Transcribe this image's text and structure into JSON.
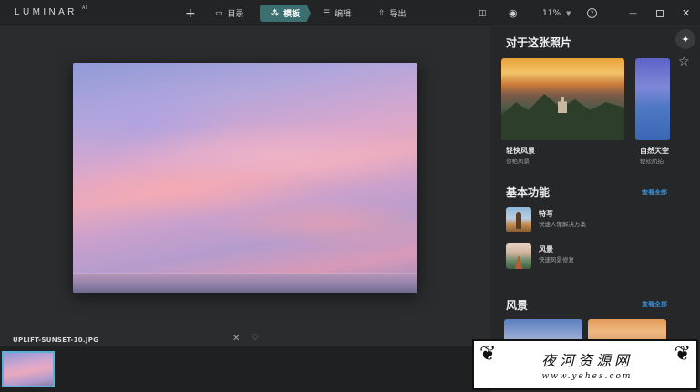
{
  "app": {
    "logo": "LUMINAR",
    "logo_version": "AI"
  },
  "toolbar": {
    "add_label": "+",
    "catalog_label": "目录",
    "template_label": "模板",
    "edit_label": "编辑",
    "export_label": "导出",
    "zoom_value": "11%",
    "help_label": "?"
  },
  "icons": {
    "catalog": "folder-icon",
    "template": "magic-wand-icon",
    "edit": "sliders-icon",
    "export": "upload-icon",
    "compare": "compare-icon",
    "preview": "eye-icon",
    "help": "help-icon",
    "favorite": "heart-icon",
    "reject": "close-icon"
  },
  "image": {
    "filename": "UPLIFT-SUNSET-10.JPG"
  },
  "panel": {
    "for_this_photo": {
      "title": "对于这张照片",
      "cards": [
        {
          "title": "轻快风景",
          "subtitle": "惊艳风景"
        },
        {
          "title": "自然天空",
          "subtitle": "轻松航拍"
        }
      ]
    },
    "essentials": {
      "title": "基本功能",
      "see_all": "查看全部",
      "items": [
        {
          "title": "特写",
          "subtitle": "快速人像解决方案"
        },
        {
          "title": "风景",
          "subtitle": "快速风景修复"
        }
      ]
    },
    "landscape": {
      "title": "风景",
      "see_all": "查看全部"
    }
  },
  "watermark": {
    "name": "夜河资源网",
    "url": "www.yehes.com"
  },
  "colors": {
    "accent": "#3b6f70",
    "link": "#3d8fd6",
    "selection": "#5ab0d6"
  }
}
